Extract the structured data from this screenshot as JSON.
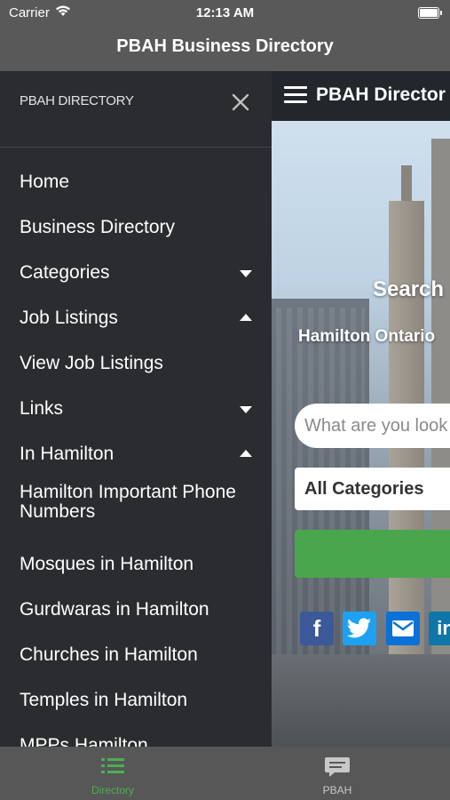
{
  "status_bar": {
    "carrier": "Carrier",
    "time": "12:13 AM"
  },
  "nav": {
    "title": "PBAH Business Directory"
  },
  "drawer": {
    "title": "PBAH DIRECTORY",
    "items": [
      {
        "label": "Home"
      },
      {
        "label": "Business Directory"
      },
      {
        "label": "Categories",
        "caret": "down"
      },
      {
        "label": "Job Listings",
        "caret": "up"
      },
      {
        "label": "View Job Listings"
      },
      {
        "label": "Links",
        "caret": "down"
      },
      {
        "label": "In Hamilton",
        "caret": "up"
      },
      {
        "label": "Hamilton Important Phone Numbers"
      },
      {
        "label": "Mosques in Hamilton"
      },
      {
        "label": "Gurdwaras in Hamilton"
      },
      {
        "label": "Churches in Hamilton"
      },
      {
        "label": "Temples in Hamilton"
      },
      {
        "label": "MPPs Hamilton"
      }
    ]
  },
  "web": {
    "header_title": "PBAH Director",
    "hero_title": "Search",
    "hero_subtitle": "Hamilton Ontario",
    "search_placeholder": "What are you look",
    "category_select": "All Categories",
    "social": [
      "facebook",
      "twitter",
      "email",
      "linkedin"
    ]
  },
  "tabs": [
    {
      "label": "Directory",
      "icon": "list-icon",
      "active": true
    },
    {
      "label": "PBAH",
      "icon": "chat-bubble-icon",
      "active": false
    }
  ],
  "colors": {
    "accent": "#4caf50",
    "drawer_bg": "#2a2c30",
    "bar_bg": "#595959"
  }
}
